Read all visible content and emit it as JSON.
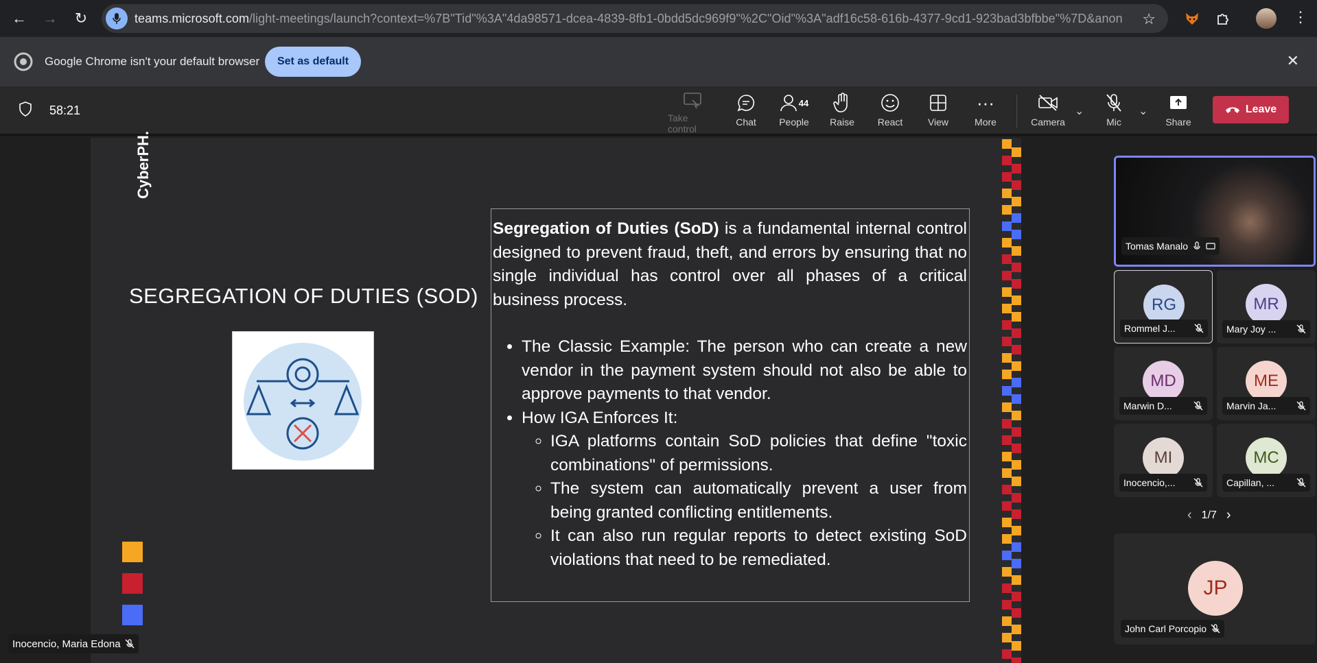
{
  "browser": {
    "url_host": "teams.microsoft.com",
    "url_rest": "/light-meetings/launch?context=%7B\"Tid\"%3A\"4da98571-dcea-4839-8fb1-0bdd5dc969f9\"%2C\"Oid\"%3A\"adf16c58-616b-4377-9cd1-923bad3bfbbe\"%7D&anon=tru...",
    "infobar_message": "Google Chrome isn't your default browser",
    "set_default_label": "Set as default"
  },
  "meeting": {
    "timer": "58:21",
    "toolbar": {
      "take_control": "Take control",
      "chat": "Chat",
      "people": "People",
      "people_count": "44",
      "raise": "Raise",
      "react": "React",
      "view": "View",
      "more": "More",
      "camera": "Camera",
      "mic": "Mic",
      "share": "Share",
      "leave": "Leave"
    }
  },
  "slide": {
    "brand": "CyberPH.",
    "title": "SEGREGATION OF DUTIES (SOD)",
    "intro_bold": "Segregation of Duties (SoD)",
    "intro_rest": " is a fundamental internal control designed to prevent fraud, theft, and errors by ensuring that no single individual has control over all phases of a critical business process.",
    "bullet1": "The Classic Example: The person who can create a new vendor in the payment system should not also be able to approve payments to that vendor.",
    "bullet2": "How IGA Enforces It:",
    "sub1": "IGA platforms contain SoD policies that define \"toxic combinations\" of permissions.",
    "sub2": "The system can automatically prevent a user from being granted conflicting entitlements.",
    "sub3": "It can also run regular reports to detect existing SoD violations that need to be remediated.",
    "colors": {
      "yellow": "#f5a623",
      "red": "#c8202f",
      "blue": "#4a6cf7"
    }
  },
  "presenter_tag": "Inocencio, Maria Edona",
  "participants": {
    "featured": {
      "name": "Tomas Manalo"
    },
    "tiles": [
      {
        "initials": "RG",
        "name": "Rommel J...",
        "bg": "#c9d6ee",
        "fg": "#2b4a86"
      },
      {
        "initials": "MR",
        "name": "Mary Joy ...",
        "bg": "#d8d4f0",
        "fg": "#4a3f86"
      },
      {
        "initials": "MD",
        "name": "Marwin D...",
        "bg": "#e7cde6",
        "fg": "#6b2e6a"
      },
      {
        "initials": "ME",
        "name": "Marvin Ja...",
        "bg": "#f6d5cf",
        "fg": "#a02c1e"
      },
      {
        "initials": "MI",
        "name": "Inocencio,...",
        "bg": "#e3dad6",
        "fg": "#5a4038"
      },
      {
        "initials": "MC",
        "name": "Capillan, ...",
        "bg": "#dfe8d2",
        "fg": "#3d5a1e"
      }
    ],
    "pager": "1/7",
    "bottom": {
      "initials": "JP",
      "name": "John Carl Porcopio",
      "bg": "#f6d5cf",
      "fg": "#a02c1e"
    }
  }
}
